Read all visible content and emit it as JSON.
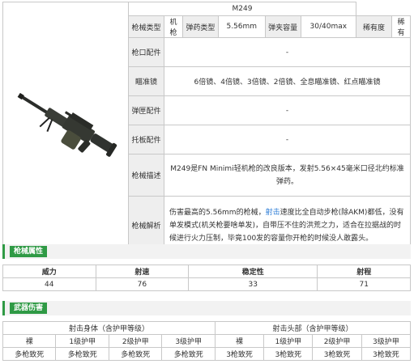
{
  "weapon": {
    "name": "M249",
    "labels": {
      "type": "枪械类型",
      "ammo_type": "弹药类型",
      "capacity": "弹夹容量",
      "rarity": "稀有度",
      "muzzle": "枪口配件",
      "scope": "瞄准镜",
      "magazine": "弹匣配件",
      "stock": "托板配件",
      "description": "枪械描述",
      "analysis": "枪械解析"
    },
    "values": {
      "type": "机枪",
      "ammo_type": "5.56mm",
      "capacity": "30/40max",
      "rarity": "稀有",
      "muzzle": "-",
      "scope": "6倍镜、4倍镜、3倍镜、2倍镜、全息瞄准镜、红点瞄准镜",
      "magazine": "-",
      "stock": "-",
      "description": "M249是FN Minimi轻机枪的改良版本，发射5.56×45毫米口径北约标准弹药。",
      "analysis_pre": "伤害最高的5.56mm的枪械，",
      "analysis_link": "射击",
      "analysis_post": "速度比全自动步枪(除AKM)都低，没有单发模式(机关枪要啥单发)，自带压不住的洪荒之力，适合在拉据战的时候进行火力压制，毕竟100发的容量你开枪的时候没人敢露头。"
    }
  },
  "attributes_section": {
    "title": "枪械属性"
  },
  "stats": {
    "headers": [
      "威力",
      "射速",
      "稳定性",
      "射程"
    ],
    "values": [
      "44",
      "76",
      "33",
      "71"
    ]
  },
  "damage_section": {
    "title": "武器伤害"
  },
  "damage": {
    "group_body": "射击身体（含护甲等级）",
    "group_head": "射击头部（含护甲等级）",
    "levels": [
      "裸",
      "1级护甲",
      "2级护甲",
      "3级护甲",
      "裸",
      "1级护甲",
      "2级护甲",
      "3级护甲"
    ],
    "results": [
      "多枪致死",
      "多枪致死",
      "多枪致死",
      "多枪致死",
      "3枪致死",
      "3枪致死",
      "3枪致死",
      "3枪致死"
    ]
  },
  "colors": {
    "accent": "#2f9a45",
    "link": "#2a7bd6",
    "label_bg": "#eeeeee"
  }
}
